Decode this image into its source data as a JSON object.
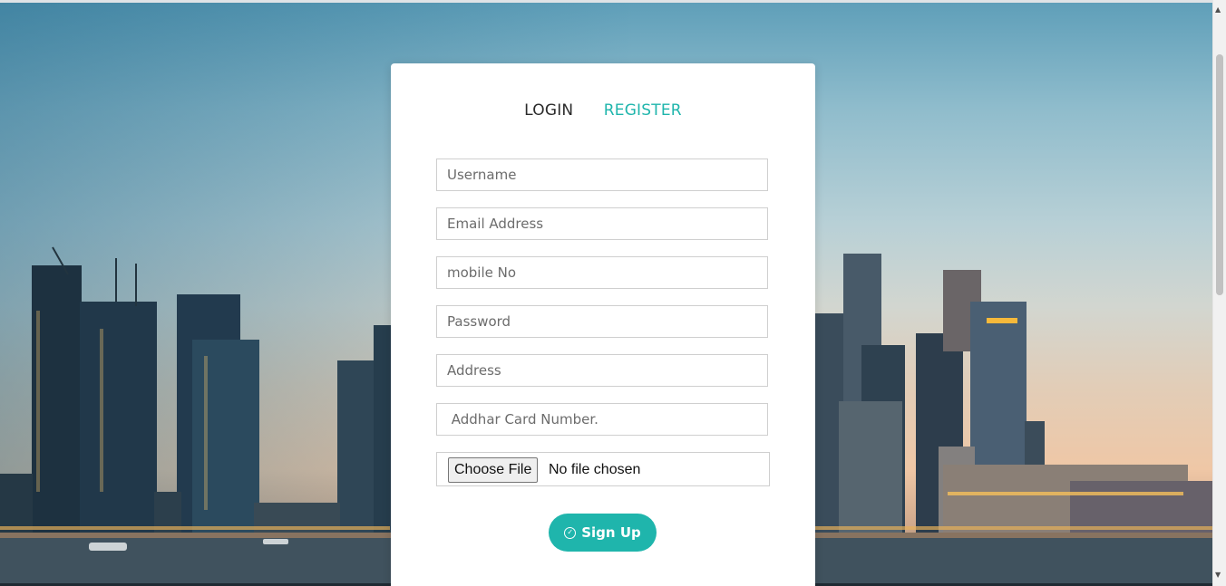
{
  "tabs": {
    "login_label": "LOGIN",
    "register_label": "REGISTER"
  },
  "form": {
    "username_placeholder": "Username",
    "email_placeholder": "Email Address",
    "mobile_placeholder": "mobile No",
    "password_placeholder": "Password",
    "address_placeholder": "Address",
    "aadhar_placeholder": " Addhar Card Number.",
    "file_button_label": "Choose File",
    "file_status": "No file chosen",
    "submit_label": "Sign Up",
    "submit_icon": "check-circle-icon"
  },
  "colors": {
    "accent": "#1fb5ac",
    "card_bg": "#ffffff"
  }
}
